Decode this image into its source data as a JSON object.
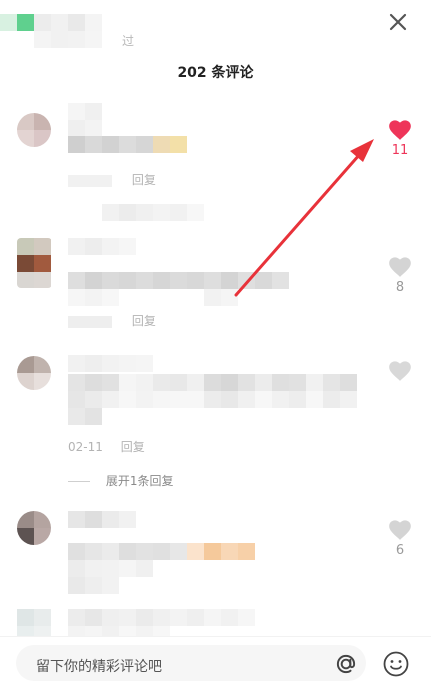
{
  "header": {
    "partial_text": "过",
    "title": "202 条评论",
    "close_icon": "close-icon"
  },
  "comments": [
    {
      "likes": "11",
      "liked": true,
      "meta_time": "",
      "meta_reply": "回复",
      "expand": ""
    },
    {
      "likes": "8",
      "liked": false,
      "meta_time": "",
      "meta_reply": "回复",
      "expand": ""
    },
    {
      "likes": "",
      "liked": false,
      "meta_time": "02-11",
      "meta_reply": "回复",
      "expand": "展开1条回复"
    },
    {
      "likes": "6",
      "liked": false,
      "meta_time": "",
      "meta_reply": "",
      "expand": ""
    }
  ],
  "input": {
    "placeholder": "留下你的精彩评论吧",
    "at_icon": "at-icon",
    "emoji_icon": "emoji-icon"
  },
  "colors": {
    "accent": "#ee3559",
    "like_inactive": "#d4d4d4",
    "arrow": "#e8323a"
  }
}
